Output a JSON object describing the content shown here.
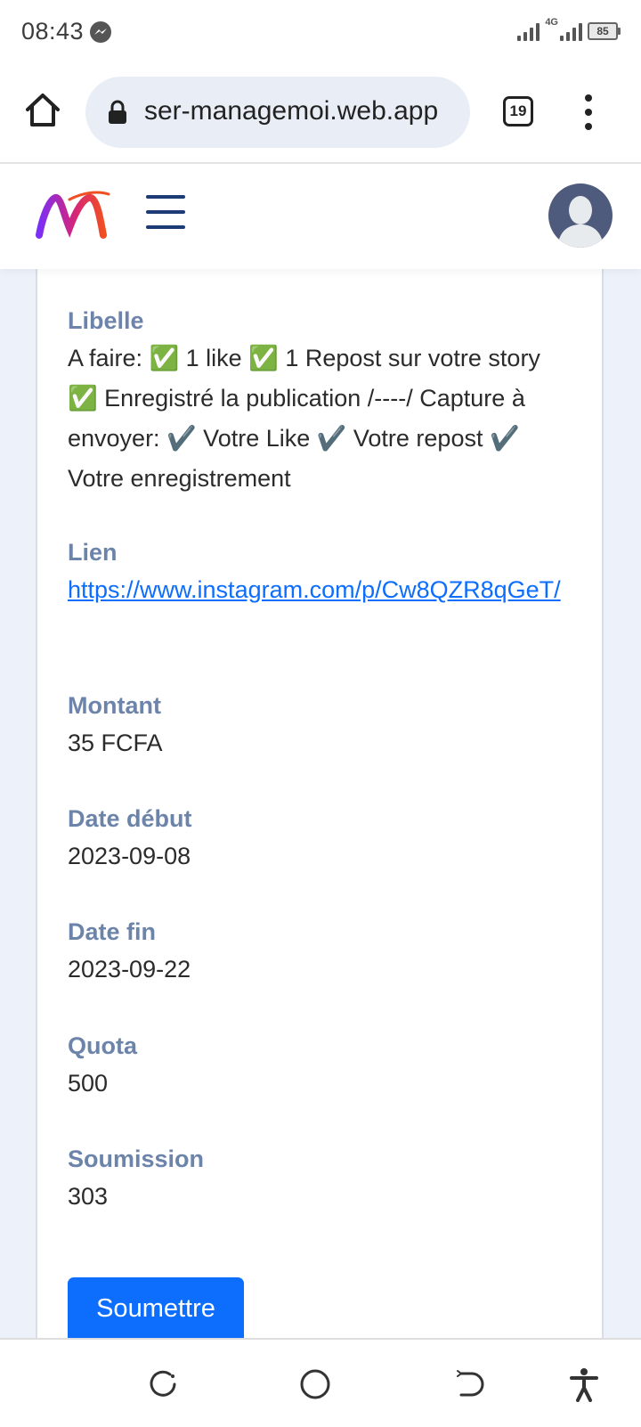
{
  "status_bar": {
    "time": "08:43",
    "network": "4G",
    "battery": "85"
  },
  "browser": {
    "url": "ser-managemoi.web.app",
    "tab_count": "19"
  },
  "details": {
    "libelle_label": "Libelle",
    "libelle_value": "A faire: ✅ 1 like ✅ 1 Repost sur votre story ✅ Enregistré la publication /----/ Capture à envoyer: ✔️ Votre Like ✔️ Votre repost ✔️ Votre enregistrement",
    "lien_label": "Lien",
    "lien_value": "https://www.instagram.com/p/Cw8QZR8qGeT/",
    "montant_label": "Montant",
    "montant_value": "35 FCFA",
    "date_debut_label": "Date début",
    "date_debut_value": "2023-09-08",
    "date_fin_label": "Date fin",
    "date_fin_value": "2023-09-22",
    "quota_label": "Quota",
    "quota_value": "500",
    "soumission_label": "Soumission",
    "soumission_value": "303",
    "submit_label": "Soumettre"
  },
  "colors": {
    "accent": "#0d6efd",
    "label": "#6c84aa",
    "page_background": "#edf1fa",
    "nav_icon": "#1d3b74"
  },
  "icons": [
    "messenger-icon",
    "home-icon",
    "lock-icon",
    "tab-switcher-icon",
    "more-vert-icon",
    "app-logo",
    "hamburger-icon",
    "user-avatar",
    "recent-apps-icon",
    "home-circle-icon",
    "back-icon",
    "accessibility-icon"
  ]
}
